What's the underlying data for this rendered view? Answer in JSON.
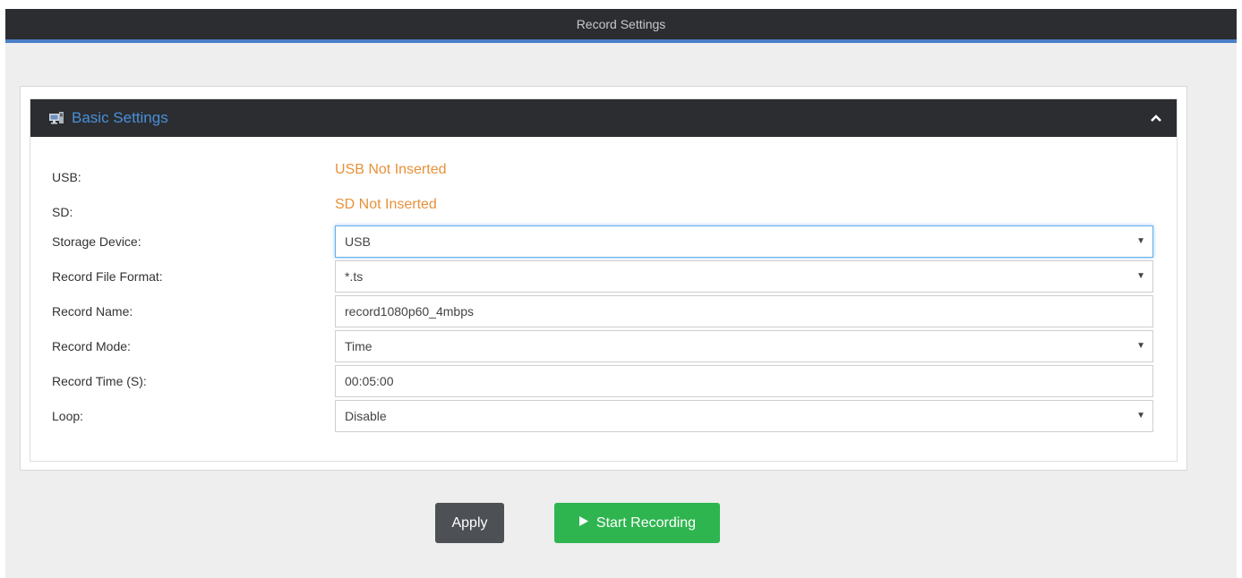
{
  "header": {
    "title": "Record Settings"
  },
  "panel": {
    "title": "Basic Settings"
  },
  "status": {
    "usb_label": "USB:",
    "usb_value": "USB Not Inserted",
    "sd_label": "SD:",
    "sd_value": "SD Not Inserted",
    "status_color": "#e8913a"
  },
  "fields": {
    "storage_device": {
      "label": "Storage Device:",
      "value": "USB"
    },
    "file_format": {
      "label": "Record File Format:",
      "value": "*.ts"
    },
    "record_name": {
      "label": "Record Name:",
      "value": "record1080p60_4mbps"
    },
    "record_mode": {
      "label": "Record Mode:",
      "value": "Time"
    },
    "record_time": {
      "label": "Record Time (S):",
      "value": "00:05:00"
    },
    "loop": {
      "label": "Loop:",
      "value": "Disable"
    }
  },
  "actions": {
    "apply_label": "Apply",
    "start_label": "Start Recording",
    "apply_color": "#4d5054",
    "start_color": "#2fb550"
  },
  "icons": {
    "panel_icon": "monitor-settings-icon",
    "collapse": "chevron-up-icon",
    "play": "play-icon",
    "dropdown": "caret-down-icon"
  }
}
